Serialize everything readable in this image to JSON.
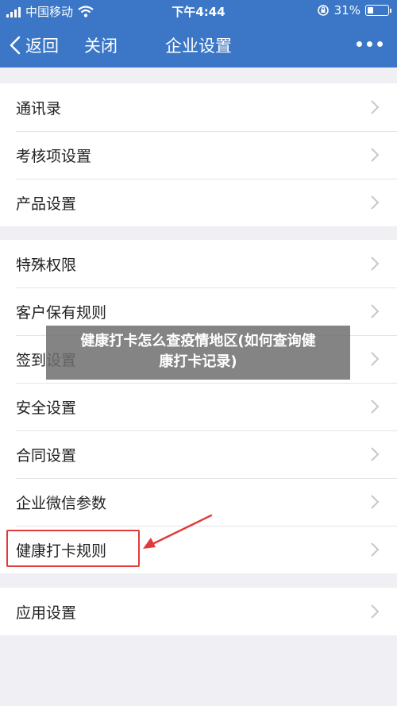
{
  "status_bar": {
    "carrier": "中国移动",
    "time": "下午4:44",
    "battery_text": "31%",
    "battery_level": 0.31
  },
  "nav": {
    "back_label": "返回",
    "close_label": "关闭",
    "title": "企业设置",
    "more_icon": "more-dots-icon"
  },
  "groups": [
    {
      "items": [
        "通讯录",
        "考核项设置",
        "产品设置"
      ]
    },
    {
      "items": [
        "特殊权限",
        "客户保有规则",
        "签到设置",
        "安全设置",
        "合同设置",
        "企业微信参数",
        "健康打卡规则"
      ]
    },
    {
      "items": [
        "应用设置"
      ]
    }
  ],
  "overlay_caption": {
    "line1": "健康打卡怎么查疫情地区(如何查询健",
    "line2": "康打卡记录)"
  },
  "colors": {
    "header": "#3b77c6",
    "background": "#efeff4",
    "highlight": "#e23a3a"
  }
}
